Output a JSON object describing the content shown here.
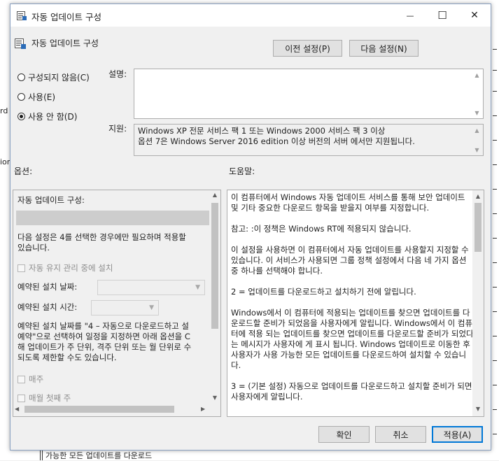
{
  "background": {
    "left_fragments": [
      "rd",
      "ion"
    ],
    "bottom_text": "가능한 모든 업데이트를 다운로드"
  },
  "window": {
    "title": "자동 업데이트 구성",
    "minimize_glyph": "—",
    "maximize_glyph": "☐",
    "close_glyph": "✕"
  },
  "header": {
    "policy_name": "자동 업데이트 구성",
    "prev_label": "이전 설정(P)",
    "next_label": "다음 설정(N)"
  },
  "state": {
    "options": [
      {
        "label": "구성되지 않음(C)",
        "selected": false
      },
      {
        "label": "사용(E)",
        "selected": false
      },
      {
        "label": "사용 안 함(D)",
        "selected": true
      }
    ]
  },
  "description": {
    "label": "설명:",
    "value": ""
  },
  "support": {
    "label": "지원:",
    "line1": "Windows XP 전문 서비스 팩 1 또는 Windows 2000 서비스 팩 3 이상",
    "line2": "옵션 7은 Windows Server 2016 edition 이상 버전의 서버 에서만 지원됩니다."
  },
  "sections": {
    "options_label": "옵션:",
    "help_label": "도움말:"
  },
  "options_panel": {
    "configure_label": "자동 업데이트 구성:",
    "note_line1": "다음 설정은 4를 선택한 경우에만 필요하며 적용할",
    "note_line2": "있습니다.",
    "maintenance_label": "자동 유지 관리 중에 설치",
    "scheduled_day_label": "예약된 설치 날짜:",
    "scheduled_time_label": "예약된 설치 시간:",
    "para_line1": "예약된 설치 날짜를 \"4 – 자동으로 다운로드하고 설",
    "para_line2": "예약\"으로 선택하여 일정을 지정하면 아래 옵션을 C",
    "para_line3": "해 업데이트가 주 단위, 격주 단위 또는 월 단위로 수",
    "para_line4": "되도록 제한할 수도 있습니다.",
    "weekly_label": "매주",
    "first_week_label": "매월 첫째 주"
  },
  "help_panel": {
    "paragraphs": [
      "이 컴퓨터에서 Windows 자동 업데이트 서비스를 통해 보안 업데이트 및 기타 중요한 다운로드 항목을 받을지 여부를 지정합니다.",
      "참고: :이 정책은 Windows RT에 적용되지 않습니다.",
      "이 설정을 사용하면 이 컴퓨터에서 자동 업데이트를 사용할지 지정할 수 있습니다. 이 서비스가 사용되면 그룹 정책 설정에서 다음 네 가지 옵션 중 하나를 선택해야 합니다.",
      " 2 = 업데이트를 다운로드하고 설치하기 전에 알립니다.",
      " Windows에서 이 컴퓨터에 적용되는 업데이트를 찾으면 업데이트를 다운로드할 준비가 되었음을 사용자에게 알립니다. Windows에서 이 컴퓨터에 적용 되는 업데이트를 찾으면 업데이트를 다운로드할 준비가 되었다는 메시지가 사용자에 게 표시 됩니다. Windows 업데이트로 이동한 후 사용자가 사용 가능한 모든 업데이트를 다운로드하여 설치할 수 있습니다.",
      " 3 = (기본 설정) 자동으로 업데이트를 다운로드하고 설치할 준비가 되면 사용자에게 알립니다."
    ]
  },
  "footer": {
    "ok_label": "확인",
    "cancel_label": "취소",
    "apply_label": "적용(A)"
  }
}
